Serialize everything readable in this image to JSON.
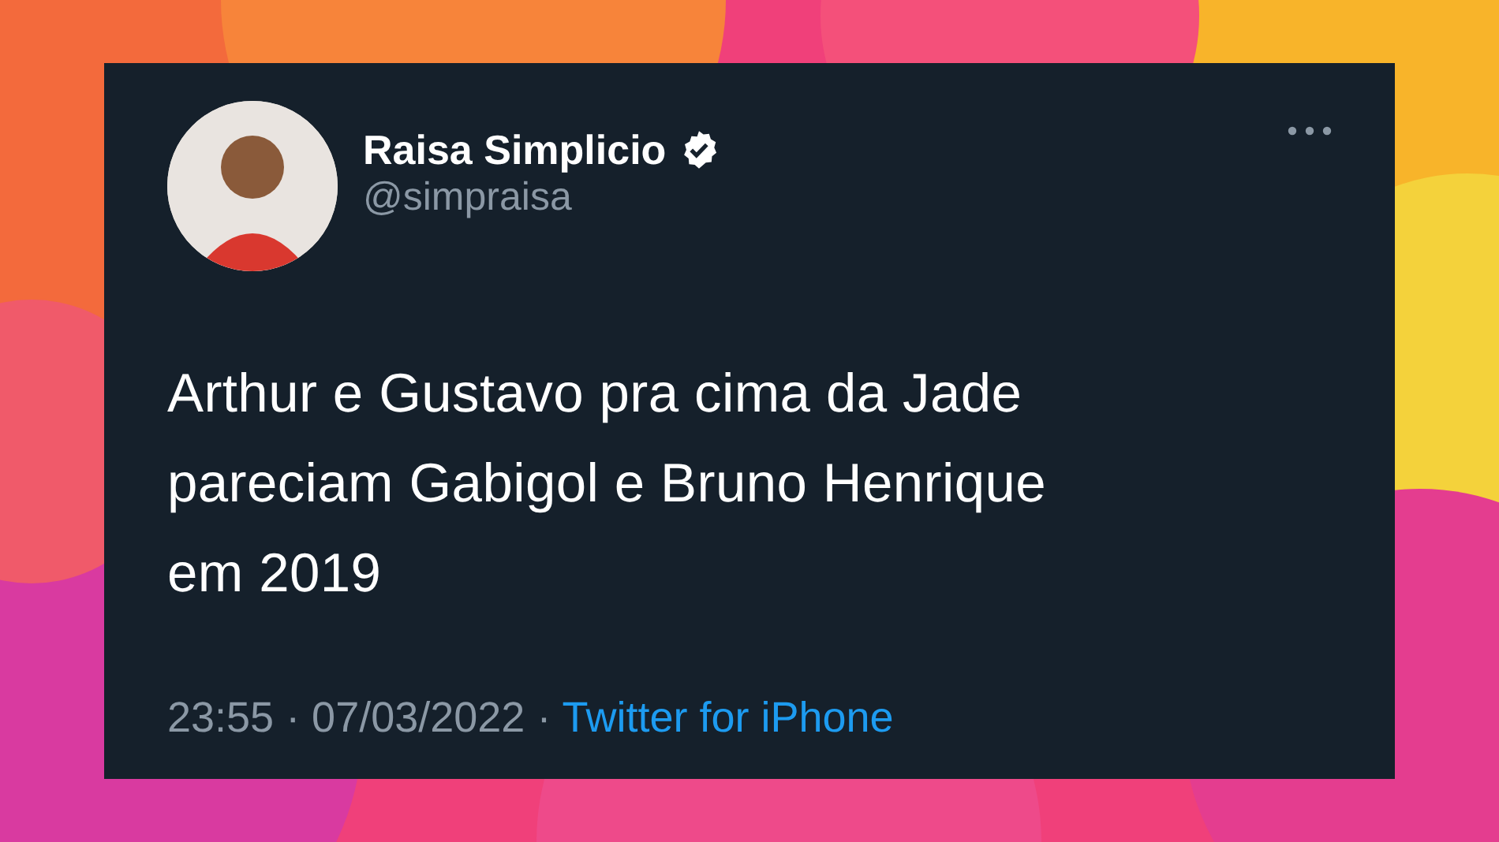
{
  "tweet": {
    "name": "Raisa Simplicio",
    "verified": true,
    "handle": "@simpraisa",
    "text": "Arthur e Gustavo pra cima da Jade\npareciam Gabigol e Bruno Henrique\nem 2019",
    "timestamp": "23:55 · 07/03/2022 ·",
    "source": "Twitter for iPhone"
  }
}
